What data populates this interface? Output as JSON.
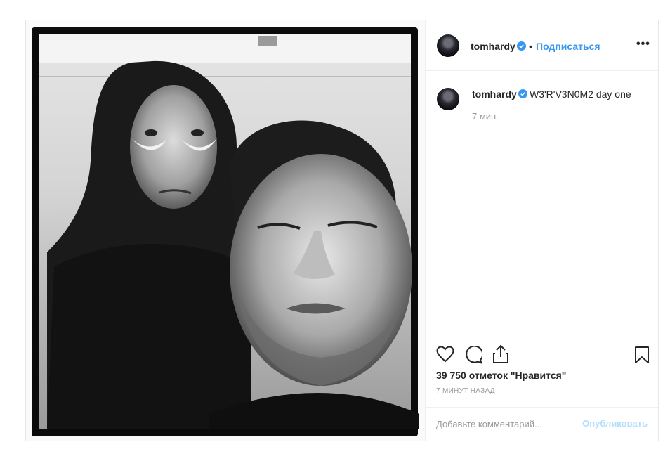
{
  "post": {
    "username": "tomhardy",
    "follow_label": "Подписаться",
    "separator": "•",
    "more_label": "•••",
    "caption": "W3'R'V3N0M2 day one",
    "caption_time": "7 мин.",
    "likes_text": "39 750 отметок \"Нравится\"",
    "time_ago": "7 МИНУТ НАЗАД",
    "comment_placeholder": "Добавьте комментарий...",
    "publish_label": "Опубликовать",
    "verified": true
  },
  "icons": {
    "like": "heart-icon",
    "comment": "comment-icon",
    "share": "share-icon",
    "save": "bookmark-icon",
    "verified": "verified-badge-icon",
    "more": "more-options-icon"
  },
  "colors": {
    "accent": "#3897f0",
    "publish_disabled": "#b2dffc",
    "muted": "#999999",
    "border": "#efefef"
  }
}
